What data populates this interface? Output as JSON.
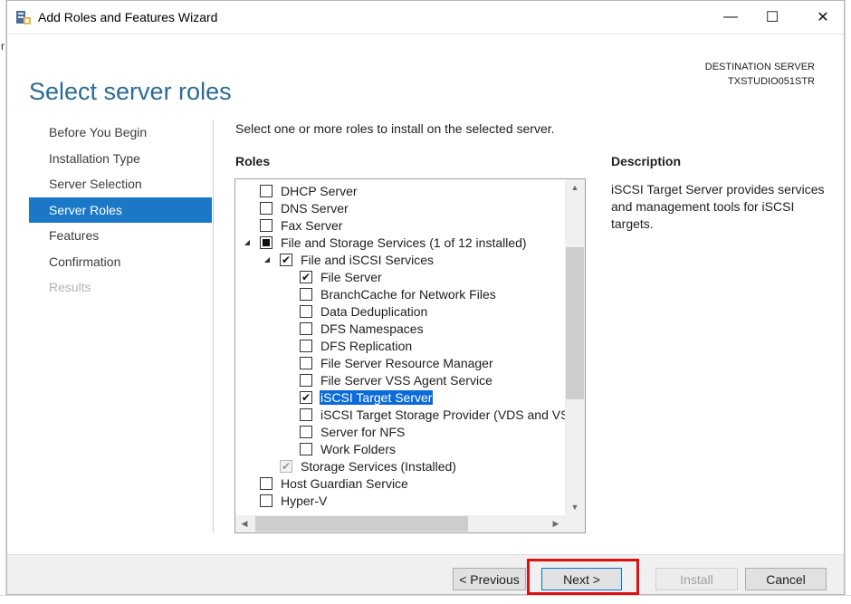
{
  "window": {
    "title": "Add Roles and Features Wizard",
    "minimize_glyph": "—",
    "maximize_glyph": "☐",
    "close_glyph": "✕"
  },
  "header": {
    "page_title": "Select server roles",
    "destination_label": "DESTINATION SERVER",
    "destination_server": "TXSTUDIO051STR"
  },
  "nav": {
    "items": [
      {
        "label": "Before You Begin",
        "state": "normal"
      },
      {
        "label": "Installation Type",
        "state": "normal"
      },
      {
        "label": "Server Selection",
        "state": "normal"
      },
      {
        "label": "Server Roles",
        "state": "active"
      },
      {
        "label": "Features",
        "state": "normal"
      },
      {
        "label": "Confirmation",
        "state": "normal"
      },
      {
        "label": "Results",
        "state": "disabled"
      }
    ]
  },
  "main": {
    "instruction": "Select one or more roles to install on the selected server.",
    "roles_heading": "Roles",
    "description_heading": "Description",
    "description_text": "iSCSI Target Server provides services and management tools for iSCSI targets."
  },
  "roles": [
    {
      "label": "DHCP Server",
      "level": 0,
      "check": "unchecked",
      "expander": ""
    },
    {
      "label": "DNS Server",
      "level": 0,
      "check": "unchecked",
      "expander": ""
    },
    {
      "label": "Fax Server",
      "level": 0,
      "check": "unchecked",
      "expander": ""
    },
    {
      "label": "File and Storage Services (1 of 12 installed)",
      "level": 0,
      "check": "partial",
      "expander": "◢"
    },
    {
      "label": "File and iSCSI Services",
      "level": 1,
      "check": "checked",
      "expander": "◢"
    },
    {
      "label": "File Server",
      "level": 2,
      "check": "checked",
      "expander": ""
    },
    {
      "label": "BranchCache for Network Files",
      "level": 2,
      "check": "unchecked",
      "expander": ""
    },
    {
      "label": "Data Deduplication",
      "level": 2,
      "check": "unchecked",
      "expander": ""
    },
    {
      "label": "DFS Namespaces",
      "level": 2,
      "check": "unchecked",
      "expander": ""
    },
    {
      "label": "DFS Replication",
      "level": 2,
      "check": "unchecked",
      "expander": ""
    },
    {
      "label": "File Server Resource Manager",
      "level": 2,
      "check": "unchecked",
      "expander": ""
    },
    {
      "label": "File Server VSS Agent Service",
      "level": 2,
      "check": "unchecked",
      "expander": ""
    },
    {
      "label": "iSCSI Target Server",
      "level": 2,
      "check": "checked",
      "expander": "",
      "selected": true
    },
    {
      "label": "iSCSI Target Storage Provider (VDS and VSS",
      "level": 2,
      "check": "unchecked",
      "expander": ""
    },
    {
      "label": "Server for NFS",
      "level": 2,
      "check": "unchecked",
      "expander": ""
    },
    {
      "label": "Work Folders",
      "level": 2,
      "check": "unchecked",
      "expander": ""
    },
    {
      "label": "Storage Services (Installed)",
      "level": 1,
      "check": "checked-disabled",
      "expander": ""
    },
    {
      "label": "Host Guardian Service",
      "level": 0,
      "check": "unchecked",
      "expander": ""
    },
    {
      "label": "Hyper-V",
      "level": 0,
      "check": "unchecked",
      "expander": ""
    }
  ],
  "buttons": {
    "previous": "< Previous",
    "next": "Next >",
    "install": "Install",
    "cancel": "Cancel"
  },
  "colors": {
    "accent": "#1a78c6",
    "title": "#2c6b94",
    "selection": "#0b6cd9",
    "annotation": "#e01010"
  }
}
